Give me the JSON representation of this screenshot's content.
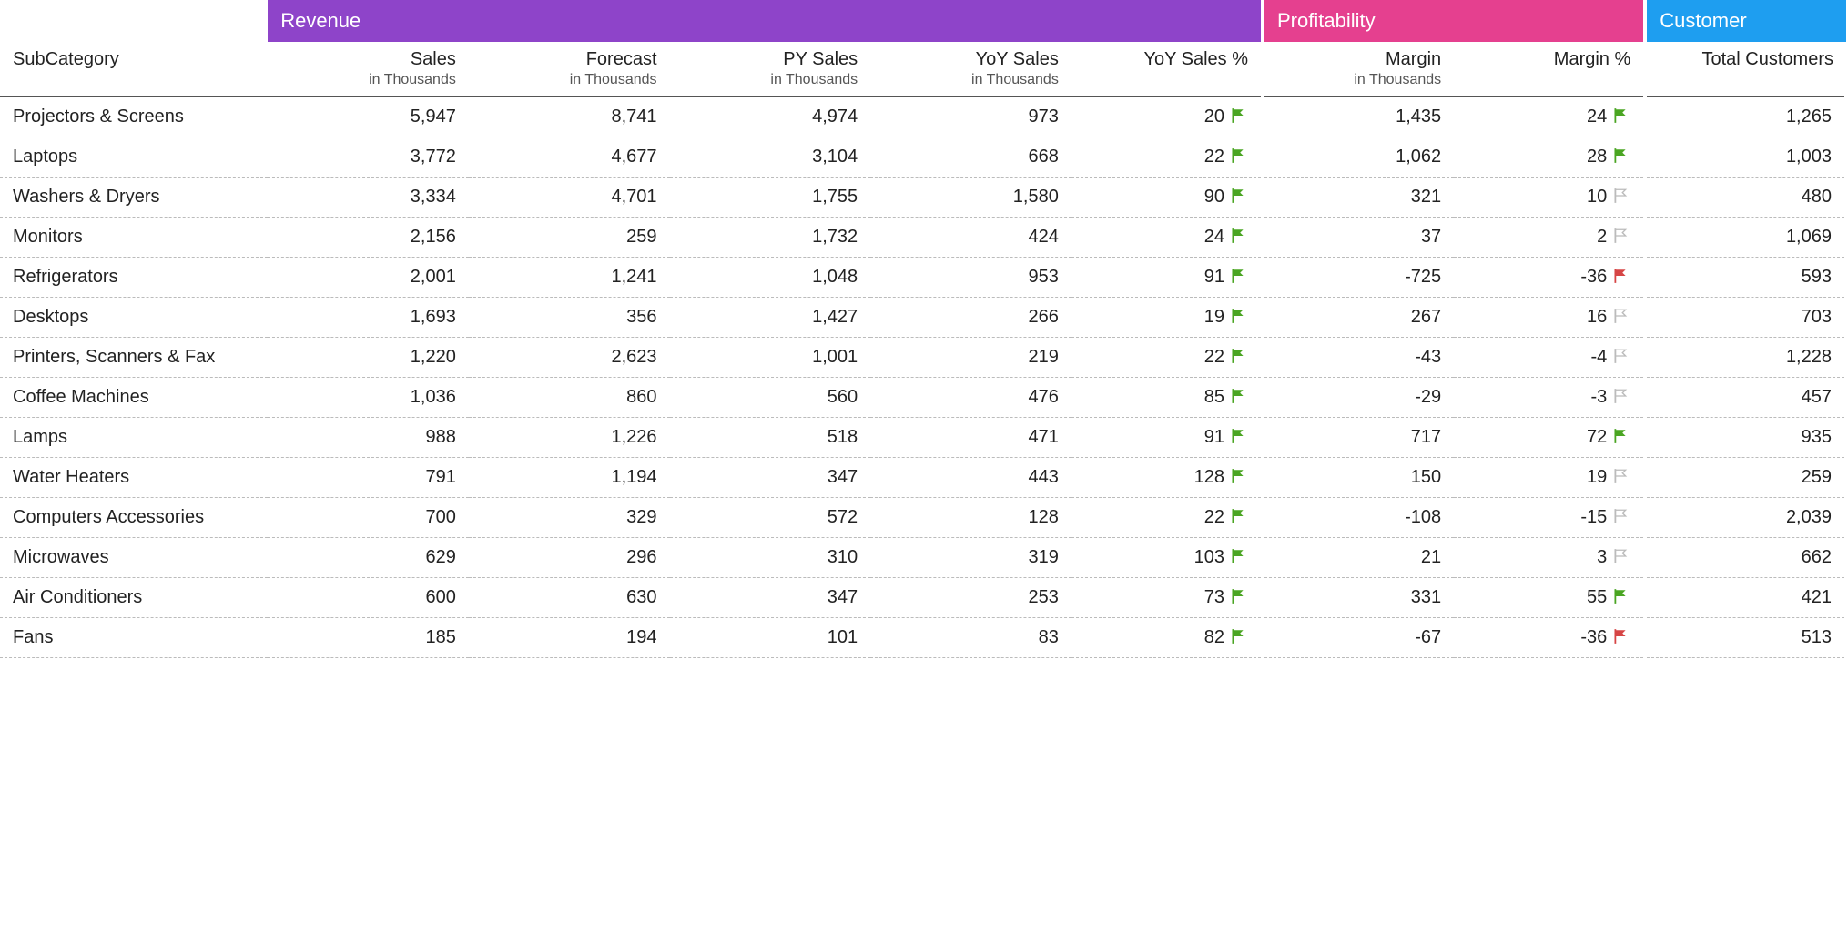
{
  "groups": [
    {
      "key": "revenue",
      "label": "Revenue",
      "color": "#8e44c9",
      "span": 5
    },
    {
      "key": "profit",
      "label": "Profitability",
      "color": "#e5408f",
      "span": 2
    },
    {
      "key": "customer",
      "label": "Customer",
      "color": "#1e9ef0",
      "span": 1
    }
  ],
  "rowHeader": "SubCategory",
  "columns": [
    {
      "key": "sales",
      "label": "Sales",
      "sub": "in Thousands",
      "group": "revenue"
    },
    {
      "key": "forecast",
      "label": "Forecast",
      "sub": "in Thousands",
      "group": "revenue"
    },
    {
      "key": "pysales",
      "label": "PY Sales",
      "sub": "in Thousands",
      "group": "revenue"
    },
    {
      "key": "yoysales",
      "label": "YoY Sales",
      "sub": "in Thousands",
      "group": "revenue"
    },
    {
      "key": "yoypct",
      "label": "YoY Sales %",
      "sub": "",
      "group": "revenue",
      "flagged": true,
      "lastInGroup": true
    },
    {
      "key": "margin",
      "label": "Margin",
      "sub": "in Thousands",
      "group": "profit"
    },
    {
      "key": "marginpct",
      "label": "Margin %",
      "sub": "",
      "group": "profit",
      "flagged": true,
      "lastInGroup": true
    },
    {
      "key": "customers",
      "label": "Total Customers",
      "sub": "",
      "group": "customer",
      "lastInGroup": true
    }
  ],
  "flags": {
    "green": "flag-green-icon",
    "red": "flag-red-icon",
    "none": "flag-outline-icon"
  },
  "rows": [
    {
      "label": "Projectors & Screens",
      "sales": "5,947",
      "forecast": "8,741",
      "pysales": "4,974",
      "yoysales": "973",
      "yoypct": "20",
      "yoyflag": "green",
      "margin": "1,435",
      "marginpct": "24",
      "marginflag": "green",
      "customers": "1,265"
    },
    {
      "label": "Laptops",
      "sales": "3,772",
      "forecast": "4,677",
      "pysales": "3,104",
      "yoysales": "668",
      "yoypct": "22",
      "yoyflag": "green",
      "margin": "1,062",
      "marginpct": "28",
      "marginflag": "green",
      "customers": "1,003"
    },
    {
      "label": "Washers & Dryers",
      "sales": "3,334",
      "forecast": "4,701",
      "pysales": "1,755",
      "yoysales": "1,580",
      "yoypct": "90",
      "yoyflag": "green",
      "margin": "321",
      "marginpct": "10",
      "marginflag": "none",
      "customers": "480"
    },
    {
      "label": "Monitors",
      "sales": "2,156",
      "forecast": "259",
      "pysales": "1,732",
      "yoysales": "424",
      "yoypct": "24",
      "yoyflag": "green",
      "margin": "37",
      "marginpct": "2",
      "marginflag": "none",
      "customers": "1,069"
    },
    {
      "label": "Refrigerators",
      "sales": "2,001",
      "forecast": "1,241",
      "pysales": "1,048",
      "yoysales": "953",
      "yoypct": "91",
      "yoyflag": "green",
      "margin": "-725",
      "marginpct": "-36",
      "marginflag": "red",
      "customers": "593"
    },
    {
      "label": "Desktops",
      "sales": "1,693",
      "forecast": "356",
      "pysales": "1,427",
      "yoysales": "266",
      "yoypct": "19",
      "yoyflag": "green",
      "margin": "267",
      "marginpct": "16",
      "marginflag": "none",
      "customers": "703"
    },
    {
      "label": "Printers, Scanners & Fax",
      "sales": "1,220",
      "forecast": "2,623",
      "pysales": "1,001",
      "yoysales": "219",
      "yoypct": "22",
      "yoyflag": "green",
      "margin": "-43",
      "marginpct": "-4",
      "marginflag": "none",
      "customers": "1,228"
    },
    {
      "label": "Coffee Machines",
      "sales": "1,036",
      "forecast": "860",
      "pysales": "560",
      "yoysales": "476",
      "yoypct": "85",
      "yoyflag": "green",
      "margin": "-29",
      "marginpct": "-3",
      "marginflag": "none",
      "customers": "457"
    },
    {
      "label": "Lamps",
      "sales": "988",
      "forecast": "1,226",
      "pysales": "518",
      "yoysales": "471",
      "yoypct": "91",
      "yoyflag": "green",
      "margin": "717",
      "marginpct": "72",
      "marginflag": "green",
      "customers": "935"
    },
    {
      "label": "Water Heaters",
      "sales": "791",
      "forecast": "1,194",
      "pysales": "347",
      "yoysales": "443",
      "yoypct": "128",
      "yoyflag": "green",
      "margin": "150",
      "marginpct": "19",
      "marginflag": "none",
      "customers": "259"
    },
    {
      "label": "Computers Accessories",
      "sales": "700",
      "forecast": "329",
      "pysales": "572",
      "yoysales": "128",
      "yoypct": "22",
      "yoyflag": "green",
      "margin": "-108",
      "marginpct": "-15",
      "marginflag": "none",
      "customers": "2,039"
    },
    {
      "label": "Microwaves",
      "sales": "629",
      "forecast": "296",
      "pysales": "310",
      "yoysales": "319",
      "yoypct": "103",
      "yoyflag": "green",
      "margin": "21",
      "marginpct": "3",
      "marginflag": "none",
      "customers": "662"
    },
    {
      "label": "Air Conditioners",
      "sales": "600",
      "forecast": "630",
      "pysales": "347",
      "yoysales": "253",
      "yoypct": "73",
      "yoyflag": "green",
      "margin": "331",
      "marginpct": "55",
      "marginflag": "green",
      "customers": "421"
    },
    {
      "label": "Fans",
      "sales": "185",
      "forecast": "194",
      "pysales": "101",
      "yoysales": "83",
      "yoypct": "82",
      "yoyflag": "green",
      "margin": "-67",
      "marginpct": "-36",
      "marginflag": "red",
      "customers": "513"
    }
  ]
}
